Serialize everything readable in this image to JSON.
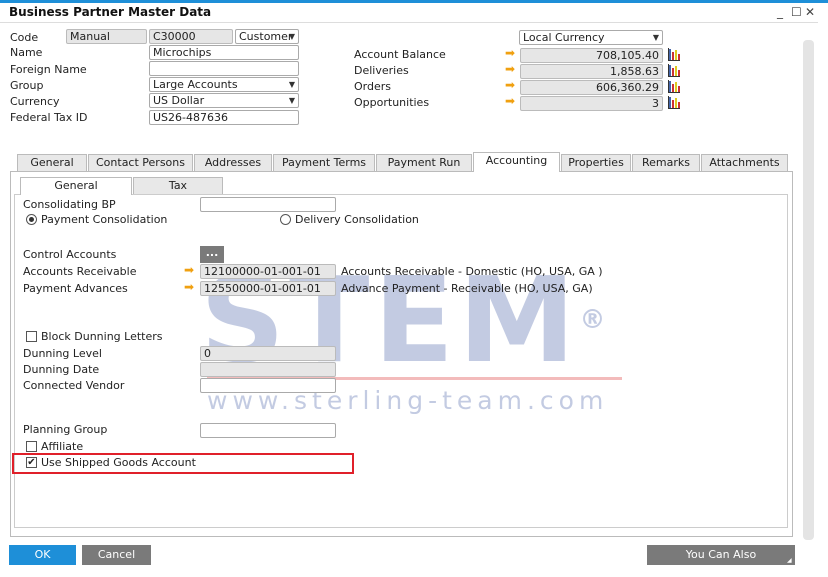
{
  "window": {
    "title": "Business Partner Master Data",
    "minimize": "_",
    "maximize": "☐",
    "close": "✕"
  },
  "header": {
    "code_label": "Code",
    "code_series": "Manual",
    "code_value": "C30000",
    "bp_type": "Customer",
    "name_label": "Name",
    "name_value": "Microchips",
    "foreign_name_label": "Foreign Name",
    "foreign_name_value": "",
    "group_label": "Group",
    "group_value": "Large Accounts",
    "currency_label": "Currency",
    "currency_value": "US Dollar",
    "tax_id_label": "Federal Tax ID",
    "tax_id_value": "US26-487636",
    "currency_mode": "Local Currency",
    "balances": [
      {
        "label": "Account Balance",
        "value": "708,105.40"
      },
      {
        "label": "Deliveries",
        "value": "1,858.63"
      },
      {
        "label": "Orders",
        "value": "606,360.29"
      },
      {
        "label": "Opportunities",
        "value": "3"
      }
    ]
  },
  "tabs": [
    {
      "label": "General"
    },
    {
      "label": "Contact Persons"
    },
    {
      "label": "Addresses"
    },
    {
      "label": "Payment Terms"
    },
    {
      "label": "Payment Run"
    },
    {
      "label": "Accounting",
      "active": true
    },
    {
      "label": "Properties"
    },
    {
      "label": "Remarks"
    },
    {
      "label": "Attachments"
    }
  ],
  "subtabs": [
    {
      "label": "General",
      "active": true
    },
    {
      "label": "Tax"
    }
  ],
  "accounting": {
    "consolidating_bp_label": "Consolidating BP",
    "consolidating_bp_value": "",
    "payment_consolidation": "Payment Consolidation",
    "delivery_consolidation": "Delivery Consolidation",
    "selected_consolidation": "Payment Consolidation",
    "control_accounts_label": "Control Accounts",
    "control_accounts_button": "...",
    "ar_label": "Accounts Receivable",
    "ar_value": "12100000-01-001-01",
    "ar_desc": "Accounts Receivable - Domestic (HO, USA, GA )",
    "pa_label": "Payment Advances",
    "pa_value": "12550000-01-001-01",
    "pa_desc": "Advance Payment - Receivable (HO, USA, GA)",
    "block_dunning_label": "Block Dunning Letters",
    "block_dunning_checked": false,
    "dunning_level_label": "Dunning Level",
    "dunning_level_value": "0",
    "dunning_date_label": "Dunning Date",
    "dunning_date_value": "",
    "connected_vendor_label": "Connected Vendor",
    "connected_vendor_value": "",
    "planning_group_label": "Planning Group",
    "planning_group_value": "",
    "affiliate_label": "Affiliate",
    "affiliate_checked": false,
    "shipped_goods_label": "Use Shipped Goods Account",
    "shipped_goods_checked": true
  },
  "footer": {
    "ok": "OK",
    "cancel": "Cancel",
    "you_can_also": "You Can Also"
  },
  "watermark": {
    "logo": "STEM®",
    "url": "www.sterling-team.com"
  },
  "colors": {
    "accent": "#1e8fd8",
    "ok_button": "#1e8fd8",
    "highlight_box": "#e0202a"
  }
}
